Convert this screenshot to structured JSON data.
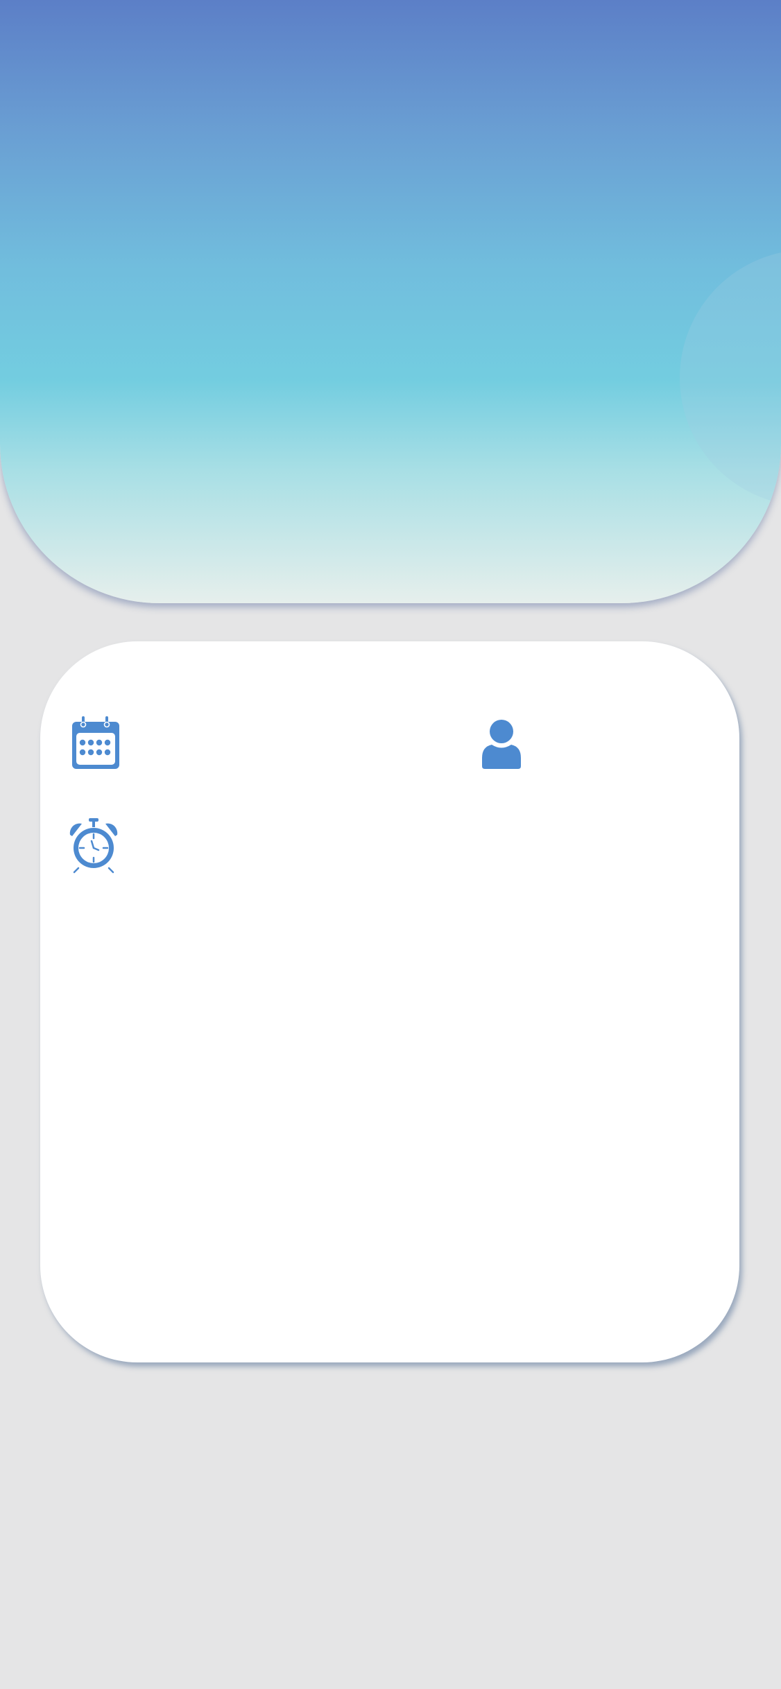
{
  "theme": {
    "accent": "#4d8ad0",
    "background": "#e5e5e6",
    "card": "#ffffff",
    "header_gradient": [
      "#5c7fc7",
      "#73cde0",
      "#e6efec"
    ]
  },
  "card": {
    "icons": [
      "calendar-icon",
      "person-icon",
      "alarm-clock-icon"
    ]
  }
}
